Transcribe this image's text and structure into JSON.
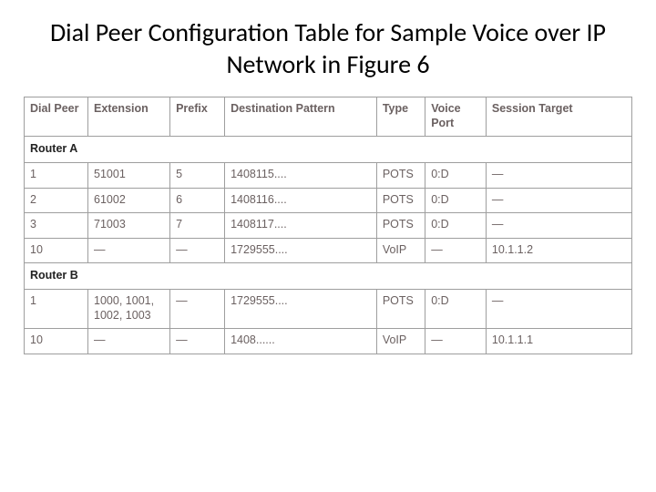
{
  "title": "Dial Peer Configuration Table for Sample Voice over IP Network  in Figure 6",
  "headers": {
    "dial_peer": "Dial Peer",
    "extension": "Extension",
    "prefix": "Prefix",
    "dest_pattern": "Destination Pattern",
    "type": "Type",
    "voice_port": "Voice Port",
    "session_target": "Session Target"
  },
  "sections": [
    {
      "label": "Router A",
      "rows": [
        {
          "dial_peer": "1",
          "extension": "51001",
          "prefix": "5",
          "dest_pattern": "1408115....",
          "type": "POTS",
          "voice_port": "0:D",
          "session_target": "—"
        },
        {
          "dial_peer": "2",
          "extension": "61002",
          "prefix": "6",
          "dest_pattern": "1408116....",
          "type": "POTS",
          "voice_port": "0:D",
          "session_target": "—"
        },
        {
          "dial_peer": "3",
          "extension": "71003",
          "prefix": "7",
          "dest_pattern": "1408117....",
          "type": "POTS",
          "voice_port": "0:D",
          "session_target": "—"
        },
        {
          "dial_peer": "10",
          "extension": "—",
          "prefix": "—",
          "dest_pattern": "1729555....",
          "type": "VoIP",
          "voice_port": "—",
          "session_target": "10.1.1.2"
        }
      ]
    },
    {
      "label": "Router B",
      "rows": [
        {
          "dial_peer": "1",
          "extension": "1000, 1001, 1002, 1003",
          "prefix": "—",
          "dest_pattern": "1729555....",
          "type": "POTS",
          "voice_port": "0:D",
          "session_target": "—"
        },
        {
          "dial_peer": "10",
          "extension": "—",
          "prefix": "—",
          "dest_pattern": "1408......",
          "type": "VoIP",
          "voice_port": "—",
          "session_target": "10.1.1.1"
        }
      ]
    }
  ]
}
